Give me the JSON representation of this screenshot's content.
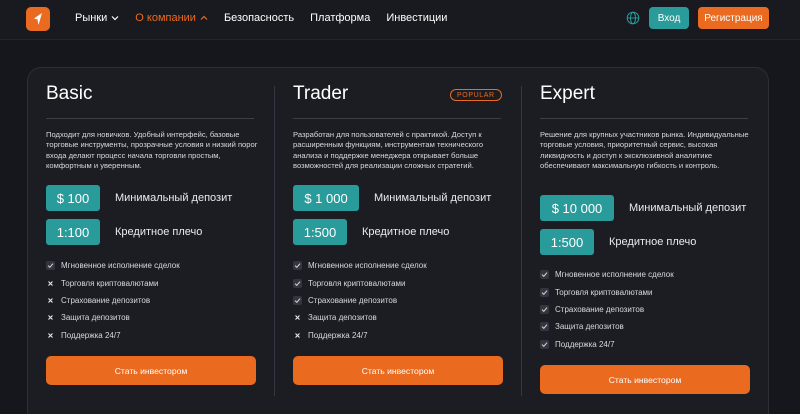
{
  "header": {
    "nav": [
      {
        "label": "Рынки",
        "dropdown": true,
        "active": false
      },
      {
        "label": "О компании",
        "dropdown": true,
        "active": true
      },
      {
        "label": "Безопасность",
        "dropdown": false,
        "active": false
      },
      {
        "label": "Платформа",
        "dropdown": false,
        "active": false
      },
      {
        "label": "Инвестиции",
        "dropdown": false,
        "active": false
      }
    ],
    "login_label": "Вход",
    "register_label": "Регистрация"
  },
  "colors": {
    "accent": "#ea6a1f",
    "teal": "#2a9b9b",
    "background": "#15171c",
    "panel": "#1b1d23"
  },
  "plans": [
    {
      "name": "Basic",
      "badge": "",
      "description": "Подходит для новичков. Удобный интерфейс, базовые торговые инструменты, прозрачные условия и низкий порог входа делают процесс начала торговли простым, комфортным и уверенным.",
      "deposit_value": "$ 100",
      "deposit_label": "Минимальный депозит",
      "leverage_value": "1:100",
      "leverage_label": "Кредитное плечо",
      "features": [
        {
          "label": "Мгновенное исполнение сделок",
          "included": true
        },
        {
          "label": "Торговля криптовалютами",
          "included": false
        },
        {
          "label": "Страхование депозитов",
          "included": false
        },
        {
          "label": "Защита депозитов",
          "included": false
        },
        {
          "label": "Поддержка 24/7",
          "included": false
        }
      ],
      "cta": "Стать инвестором"
    },
    {
      "name": "Trader",
      "badge": "POPULAR",
      "description": "Разработан для пользователей с практикой. Доступ к расширенным функциям, инструментам технического анализа и поддержке менеджера открывает больше возможностей для реализации сложных стратегий.",
      "deposit_value": "$ 1 000",
      "deposit_label": "Минимальный депозит",
      "leverage_value": "1:500",
      "leverage_label": "Кредитное плечо",
      "features": [
        {
          "label": "Мгновенное исполнение сделок",
          "included": true
        },
        {
          "label": "Торговля криптовалютами",
          "included": true
        },
        {
          "label": "Страхование депозитов",
          "included": true
        },
        {
          "label": "Защита депозитов",
          "included": false
        },
        {
          "label": "Поддержка 24/7",
          "included": false
        }
      ],
      "cta": "Стать инвестором"
    },
    {
      "name": "Expert",
      "badge": "",
      "description": "Решение для крупных участников рынка. Индивидуальные торговые условия, приоритетный сервис, высокая ликвидность и доступ к эксклюзивной аналитике обеспечивают максимальную гибкость и контроль.",
      "deposit_value": "$ 10 000",
      "deposit_label": "Минимальный депозит",
      "leverage_value": "1:500",
      "leverage_label": "Кредитное плечо",
      "features": [
        {
          "label": "Мгновенное исполнение сделок",
          "included": true
        },
        {
          "label": "Торговля криптовалютами",
          "included": true
        },
        {
          "label": "Страхование депозитов",
          "included": true
        },
        {
          "label": "Защита депозитов",
          "included": true
        },
        {
          "label": "Поддержка 24/7",
          "included": true
        }
      ],
      "cta": "Стать инвестором"
    }
  ]
}
